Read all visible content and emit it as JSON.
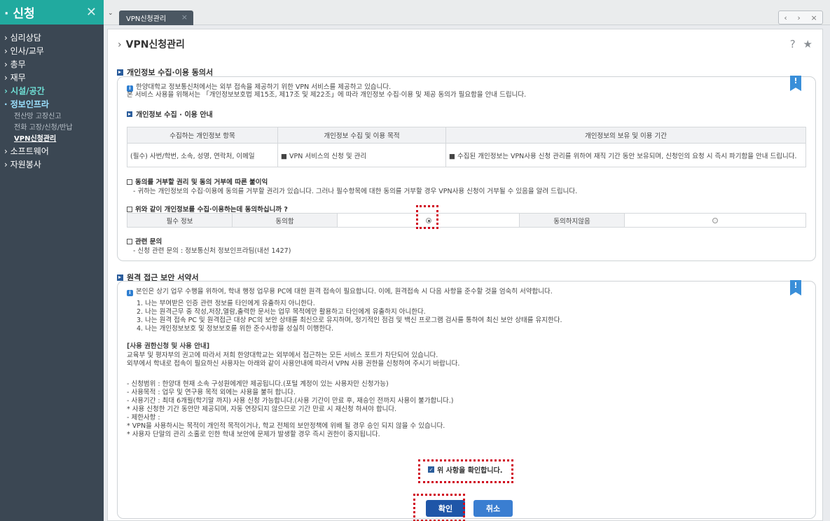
{
  "sidebar": {
    "title": "신청",
    "close": "✕",
    "items": [
      {
        "label": "심리상담"
      },
      {
        "label": "인사/교무"
      },
      {
        "label": "총무"
      },
      {
        "label": "재무"
      },
      {
        "label": "시설/공간"
      },
      {
        "label": "정보인프라"
      },
      {
        "label": "소프트웨어"
      },
      {
        "label": "자원봉사"
      }
    ],
    "sub_items": [
      {
        "label": "전산망 고장신고"
      },
      {
        "label": "전화 고장/신청/반납"
      },
      {
        "label": "VPN신청관리"
      }
    ]
  },
  "tabbar": {
    "tab_label": "VPN신청관리",
    "tab_close": "×",
    "nav_prev": "‹",
    "nav_next": "›",
    "nav_close": "×"
  },
  "page": {
    "title": "VPN신청관리",
    "help": "?",
    "star": "★"
  },
  "section1": {
    "title": "개인정보 수집·이용 동의서",
    "note1": "한양대학교 정보통신처에서는 외부 접속을 제공하기 위한 VPN 서비스를 제공하고 있습니다.",
    "note2": "본 서비스 사용을 위해서는 「개인정보보호법 제15조, 제17조 및 제22조」에 따라 개인정보 수집·이용 및 제공 동의가 필요함을 안내 드립니다.",
    "guide_title": "개인정보 수집 · 이용 안내",
    "table_headers": [
      "수집하는 개인정보 항목",
      "개인정보 수집 및 이용 목적",
      "개인정보의 보유 및 이용 기간"
    ],
    "table_row": [
      "(필수) 사번/학번, 소속, 성명, 연락처, 이메일",
      "■ VPN 서비스의 신청 및 관리",
      "■ 수집된 개인정보는 VPN사용 신청 관리를 위하여 재직 기간 동안 보유되며, 신청인의 요청 시 즉시 파기함을 안내 드립니다."
    ],
    "refuse_title": "동의를 거부할 권리 및 동의 거부에 따른 불이익",
    "refuse_desc": "- 귀하는 개인정보의 수집·이용에 동의를 거부할 권리가 있습니다. 그러나 필수항목에 대한 동의를 거부할 경우 VPN사용 신청이 거부될 수 있음을 알려 드립니다.",
    "agree_question": "위와 같이 개인정보를 수집·이용하는데 동의하십니까 ?",
    "agree_label": "필수 정보",
    "agree_yes": "동의함",
    "agree_no": "동의하지않음",
    "contact_title": "관련 문의",
    "contact_desc": "- 신청 관련 문의 : 정보통신처 정보인프라팀(내선 1427)",
    "bookmark": "!"
  },
  "section2": {
    "title": "원격 접근 보안 서약서",
    "intro": "본인은 상기 업무 수행을 위하여, 학내 행정 업무용 PC에 대한 원격 접속이 필요합니다. 이에, 원격접속 시 다음 사항을 준수할 것을 엄숙히 서약합니다.",
    "rules": [
      "1. 나는 부여받은 인증 관련 정보를 타인에게 유출하지 아니한다.",
      "2. 나는 원격근무 중 작성,저장,열람,출력한 문서는 업무 목적에만 활용하고 타인에게 유출하지 아니한다.",
      "3. 나는 원격 접속 PC 및 원격접근 대상 PC의 보안 상태를 최신으로 유지하며, 정기적인 점검 및 백신 프로그램 검사를 통하여 최신 보안 상태를 유지한다.",
      "4. 나는 개인정보보호 및 정보보호를 위한 준수사항을 성실히 이행한다."
    ],
    "usage_title": "[사용 권한신청 및 사용 안내]",
    "usage_desc1": "교육부 및 평자부의 권고에 따라서 저희 한양대학교는 외부에서 접근하는 모든 서비스 포트가 차단되어 있습니다.",
    "usage_desc2": "외부에서 학내로 접속이 필요하신 사용자는 아래와 같이 사용안내에 따라서 VPN 사용 권한을 신청하여 주시기 바랍니다.",
    "usage_items": [
      "- 신청범위 : 한양대 현재 소속 구성원에게만 제공됩니다.(포털 계정이 있는 사용자만 신청가능)",
      "- 사용목적 : 업무 및 연구용 목적 외에는 사용을 불허 합니다.",
      "- 사용기간 : 최대 6개월(학기말 까지) 사용 신청 가능합니다.(사용 기간이 만료 후, 재승인 전까지 사용이 불가합니다.)",
      "* 사용 신청한 기간 동안만 제공되며, 자동 연장되지 않으므로 기간 만료 시 재신청 하셔야 합니다.",
      "- 제한사항 :",
      "* VPN을 사용하시는 목적이 개인적 목적이거나, 학교 전체의 보안정책에 위배 될 경우 승인 되지 않을 수 있습니다.",
      "* 사용자 단말의 관리 소홀로 인한 학내 보안에 문제가 발생할 경우 즉시 권한이 중지됩니다."
    ],
    "confirm_label": "위 사항을 확인합니다.",
    "bookmark": "!"
  },
  "buttons": {
    "ok": "확인",
    "cancel": "취소"
  },
  "colors": {
    "sidebar_bg": "#3b4753",
    "sidebar_head": "#21aa9f",
    "accent_blue": "#1f56a8",
    "highlight_red": "#d0021b"
  }
}
